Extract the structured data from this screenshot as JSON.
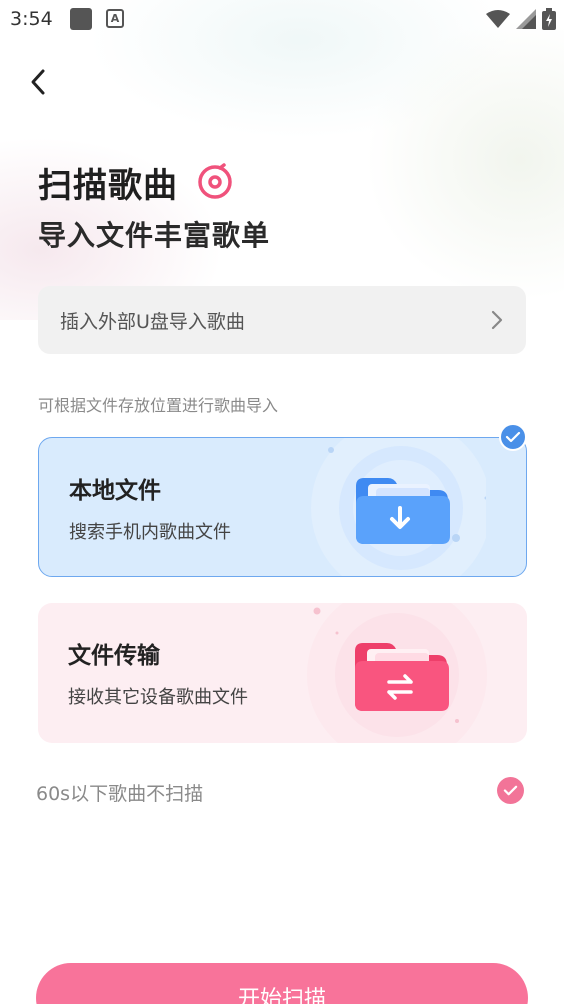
{
  "status_bar": {
    "time": "3:54",
    "notification_icon": "A"
  },
  "header": {
    "title": "扫描歌曲",
    "subtitle": "导入文件丰富歌单"
  },
  "usb_import": {
    "label": "插入外部U盘导入歌曲"
  },
  "hint": "可根据文件存放位置进行歌曲导入",
  "options": [
    {
      "title": "本地文件",
      "desc": "搜索手机内歌曲文件",
      "selected": true,
      "icon": "download-folder-icon"
    },
    {
      "title": "文件传输",
      "desc": "接收其它设备歌曲文件",
      "selected": false,
      "icon": "transfer-folder-icon"
    }
  ],
  "skip_short": {
    "label": "60s以下歌曲不扫描",
    "checked": true
  },
  "start_button": {
    "label": "开始扫描"
  },
  "colors": {
    "accent_pink": "#f8739a",
    "accent_blue": "#4a90e8",
    "local_card_bg": "#d9ebfd",
    "transfer_card_bg": "#fdeef2"
  }
}
